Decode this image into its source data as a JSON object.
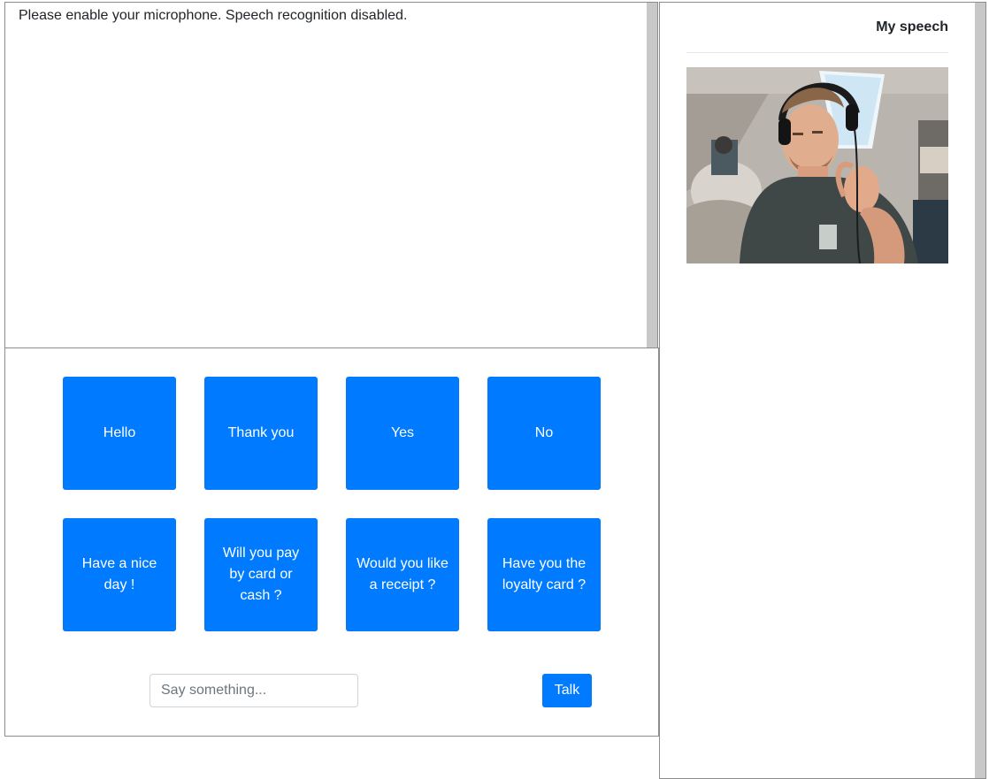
{
  "transcript": {
    "status_message": "Please enable your microphone. Speech recognition disabled."
  },
  "phrases": [
    {
      "label": "Hello"
    },
    {
      "label": "Thank you"
    },
    {
      "label": "Yes"
    },
    {
      "label": "No"
    },
    {
      "label": "Have a nice day !"
    },
    {
      "label": "Will you pay by card or cash ?"
    },
    {
      "label": "Would you like a receipt ?"
    },
    {
      "label": "Have you the loyalty card ?"
    }
  ],
  "input": {
    "placeholder": "Say something...",
    "value": ""
  },
  "talk_button": {
    "label": "Talk"
  },
  "speech_panel": {
    "title": "My speech"
  },
  "webcam": {
    "icon": "webcam-video-feed"
  },
  "colors": {
    "button_primary": "#007bff",
    "panel_border": "#8c8c8c",
    "scrollbar": "#c8c8c8"
  }
}
